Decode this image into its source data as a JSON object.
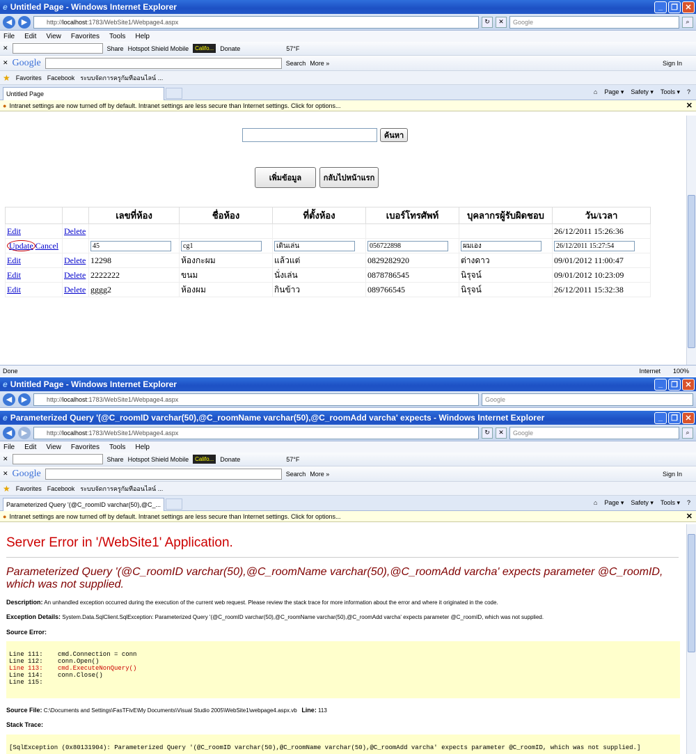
{
  "win1": {
    "title": "Untitled Page - Windows Internet Explorer",
    "url_prefix": "http://",
    "url_host": "localhost",
    "url_rest": ":1783/WebSite1/Webpage4.aspx",
    "search_placeholder": "Google",
    "menu": [
      "File",
      "Edit",
      "View",
      "Favorites",
      "Tools",
      "Help"
    ],
    "tb1_items": [
      "Share",
      "Hotspot Shield Mobile",
      "Califo...",
      "Donate",
      "57°F"
    ],
    "google_search_label": "Search",
    "google_more": "More »",
    "sign_in": "Sign In",
    "favorites": "Favorites",
    "fav_links": [
      "Facebook",
      "ระบบจัดการครูกัมทีออนไลน์ ..."
    ],
    "tab_title": "Untitled Page",
    "cmd": [
      "Page ▾",
      "Safety ▾",
      "Tools ▾"
    ],
    "infobar": "Intranet settings are now turned off by default. Intranet settings are less secure than Internet settings. Click for options...",
    "search_button": "ค้นหา",
    "add_button": "เพิ่มข้อมูล",
    "home_button": "กลับไปหน้าแรก",
    "table": {
      "headers": [
        "เลขที่ห้อง",
        "ชื่อห้อง",
        "ที่ตั้งห้อง",
        "เบอร์โทรศัพท์",
        "บุคลากรผู้รับผิดชอบ",
        "วัน/เวลา"
      ],
      "edit": "Edit",
      "delete": "Delete",
      "update": "Update",
      "cancel": "Cancel",
      "row0": [
        "",
        "",
        "",
        "",
        "",
        "26/12/2011 15:26:36"
      ],
      "edit_row": [
        "45",
        "cg1",
        "เดินเล่น",
        "056722898",
        "ผมเอง",
        "26/12/2011 15:27:54"
      ],
      "row2": [
        "12298",
        "ห้องกะผม",
        "แล้วแต่",
        "0829282920",
        "ต่างดาว",
        "09/01/2012 11:00:47"
      ],
      "row3": [
        "2222222",
        "ขนม",
        "นั่งเล่น",
        "0878786545",
        "นิรุจน์",
        "09/01/2012 10:23:09"
      ],
      "row4": [
        "gggg2",
        "ห้องผม",
        "กินข้าว",
        "089766545",
        "นิรุจน์",
        "26/12/2011 15:32:38"
      ]
    },
    "status_done": "Done",
    "status_zone": "Internet",
    "zoom": "100%"
  },
  "win2": {
    "title": "Untitled Page - Windows Internet Explorer"
  },
  "win3": {
    "title": "Parameterized Query '(@C_roomID varchar(50),@C_roomName varchar(50),@C_roomAdd varcha' expects - Windows Internet Explorer",
    "tab_title": "Parameterized Query '(@C_roomID varchar(50),@C_...",
    "err_title": "Server Error in '/WebSite1' Application.",
    "err_msg": "Parameterized Query '(@C_roomID varchar(50),@C_roomName varchar(50),@C_roomAdd varcha' expects parameter @C_roomID, which was not supplied.",
    "desc_label": "Description:",
    "desc_text": "An unhandled exception occurred during the execution of the current web request. Please review the stack trace for more information about the error and where it originated in the code.",
    "exc_label": "Exception Details:",
    "exc_text": "System.Data.SqlClient.SqlException: Parameterized Query '(@C_roomID varchar(50),@C_roomName varchar(50),@C_roomAdd varcha' expects parameter @C_roomID, which was not supplied.",
    "src_err_label": "Source Error:",
    "code": [
      {
        "n": "Line 111:",
        "c": "cmd.Connection = conn"
      },
      {
        "n": "Line 112:",
        "c": "conn.Open()"
      },
      {
        "n": "Line 113:",
        "c": "cmd.ExecuteNonQuery()"
      },
      {
        "n": "Line 114:",
        "c": "conn.Close()"
      },
      {
        "n": "Line 115:",
        "c": ""
      }
    ],
    "src_file_label": "Source File:",
    "src_file": "C:\\Documents and Settings\\FasTFivE\\My Documents\\Visual Studio 2005\\WebSite1\\webpage4.aspx.vb",
    "line_label": "Line:",
    "line_no": "113",
    "stack_label": "Stack Trace:",
    "stack_text": "[SqlException (0x80131904): Parameterized Query '(@C_roomID varchar(50),@C_roomName varchar(50),@C_roomAdd varcha' expects parameter @C_roomID, which was not supplied.]"
  }
}
